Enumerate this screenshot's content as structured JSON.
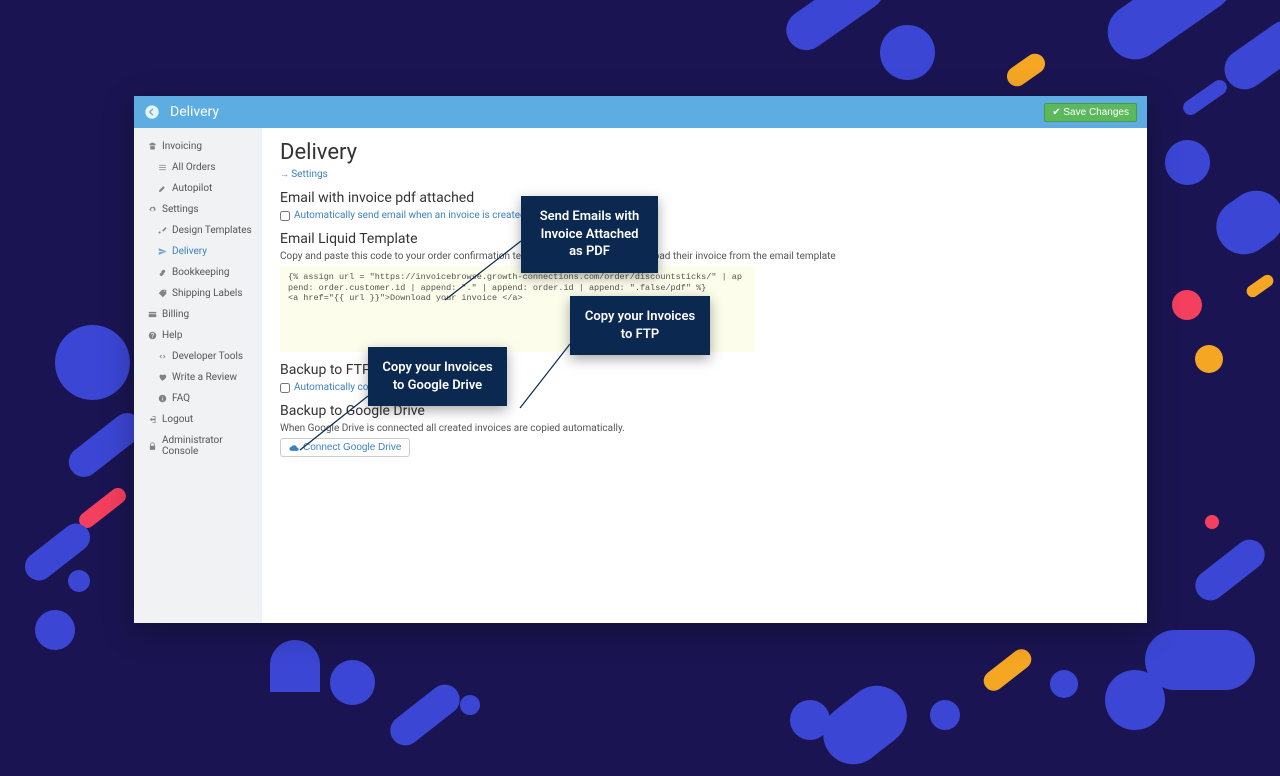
{
  "topbar": {
    "title": "Delivery",
    "save_label": "Save Changes"
  },
  "sidebar": {
    "invoicing": "Invoicing",
    "all_orders": "All Orders",
    "autopilot": "Autopilot",
    "settings": "Settings",
    "design_templates": "Design Templates",
    "delivery": "Delivery",
    "bookkeeping": "Bookkeeping",
    "shipping_labels": "Shipping Labels",
    "billing": "Billing",
    "help": "Help",
    "developer_tools": "Developer Tools",
    "write_review": "Write a Review",
    "faq": "FAQ",
    "logout": "Logout",
    "admin_console": "Administrator Console"
  },
  "main": {
    "page_title": "Delivery",
    "settings_link": "Settings",
    "email_pdf_h": "Email with invoice pdf attached",
    "email_pdf_chk": "Automatically send email when an invoice is created.",
    "liquid_h": "Email Liquid Template",
    "liquid_desc": "Copy and paste this code to your order confirmation template. Customers can download their invoice from the email template",
    "liquid_code": "{% assign url = \"https://invoicebrowse.growth-connections.com/order/discountsticks/\" | append: order.customer.id | append: \".\" | append: order.id | append: \".false/pdf\" %}\n<a href=\"{{ url }}\">Download your invoice </a>",
    "ftp_h": "Backup to FTP",
    "ftp_chk": "Automatically copy invoices to FTP",
    "gdrive_h": "Backup to Google Drive",
    "gdrive_desc": "When Google Drive is connected all created invoices are copied automatically.",
    "gdrive_btn": "Connect Google Drive"
  },
  "callouts": {
    "c1": "Send Emails with Invoice Attached as PDF",
    "c2": "Copy your Invoices to FTP",
    "c3": "Copy your Invoices to Google Drive"
  }
}
